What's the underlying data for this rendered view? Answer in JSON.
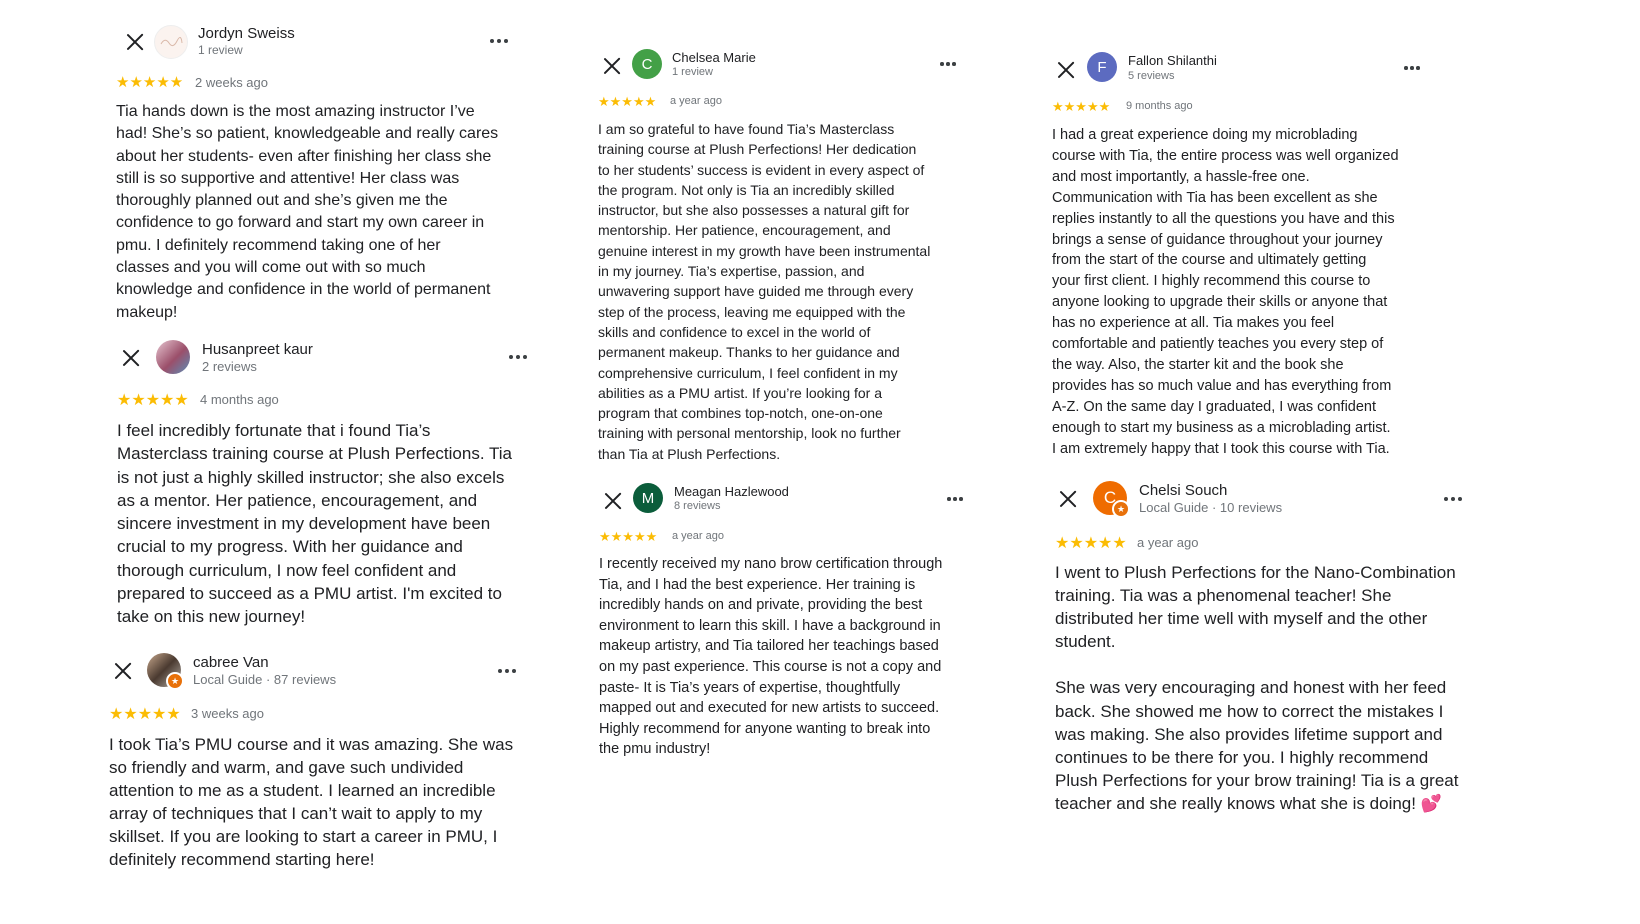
{
  "reviews": [
    {
      "name": "Jordyn Sweiss",
      "meta": "1 review",
      "stars": "★★★★★",
      "date": "2 weeks ago",
      "avatar_icon": "logo-image-avatar",
      "text": "Tia hands down is the most amazing instructor I’ve\nhad! She’s so patient, knowledgeable and really cares\nabout her students- even after finishing her class she\nstill is so supportive and attentive! Her class was\nthoroughly planned out and she’s given me the\nconfidence to go forward and start my own career in\npmu. I definitely recommend taking one of her\nclasses and you will come out with so much\nknowledge and confidence in the world of permanent\nmakeup!"
    },
    {
      "name": "Husanpreet kaur",
      "meta": "2 reviews",
      "stars": "★★★★★",
      "date": "4 months ago",
      "avatar_icon": "photo-avatar",
      "text": "I feel incredibly fortunate that i found Tia’s\nMasterclass training course at Plush Perfections. Tia\nis not just a highly skilled instructor; she also excels\nas a mentor. Her patience, encouragement, and\nsincere investment in my development have been\ncrucial to my progress. With her guidance and\nthorough curriculum, I now feel confident and\nprepared to succeed as a PMU artist. I'm excited to\ntake on this new journey!"
    },
    {
      "name": "cabree Van",
      "meta": "Local Guide · 87 reviews",
      "stars": "★★★★★",
      "date": "3 weeks ago",
      "avatar_icon": "photo-avatar",
      "text": "I took Tia’s PMU course and it was amazing. She was\nso friendly and warm, and gave such undivided\nattention to me as a student. I learned an incredible\narray of techniques that I can’t wait to apply to my\nskillset. If you are looking to start a career in PMU, I\ndefinitely recommend starting here!"
    },
    {
      "name": "Chelsea Marie",
      "meta": "1 review",
      "stars": "★★★★★",
      "date": "a year ago",
      "avatar_letter": "C",
      "avatar_color": "#43a047",
      "text": "I am so grateful to have found Tia’s Masterclass\ntraining course at Plush Perfections! Her dedication\nto her students’ success is evident in every aspect of\nthe program. Not only is Tia an incredibly skilled\ninstructor, but she also possesses a natural gift for\nmentorship. Her patience, encouragement, and\ngenuine interest in my growth have been instrumental\nin my journey. Tia’s expertise, passion, and\nunwavering support have guided me through every\nstep of the process, leaving me equipped with the\nskills and confidence to excel in the world of\npermanent makeup. Thanks to her guidance and\ncomprehensive curriculum, I feel confident in my\nabilities as a PMU artist. If you’re looking for a\nprogram that combines top-notch, one-on-one\ntraining with personal mentorship, look no further\nthan Tia at Plush Perfections."
    },
    {
      "name": "Meagan Hazlewood",
      "meta": "8 reviews",
      "stars": "★★★★★",
      "date": "a year ago",
      "avatar_letter": "M",
      "avatar_color": "#0b5d3b",
      "text": "I recently received my nano brow certification through\nTia, and I had the best experience. Her training is\nincredibly hands on and private, providing the best\nenvironment to learn this skill. I have a background in\nmakeup artistry, and Tia tailored her teachings based\non my past experience. This course is not a copy and\npaste- It is Tia’s years of expertise, thoughtfully\nmapped out and executed for new artists to succeed.\nHighly recommend for anyone wanting to break into\nthe pmu industry!"
    },
    {
      "name": "Fallon Shilanthi",
      "meta": "5 reviews",
      "stars": "★★★★★",
      "date": "9 months ago",
      "avatar_letter": "F",
      "avatar_color": "#5c6bc0",
      "text": "I had a great experience doing my microblading\ncourse with Tia, the entire process was well organized\nand most importantly, a hassle-free one.\nCommunication with Tia has been excellent as she\nreplies instantly to all the questions you have and this\nbrings a sense of guidance throughout your journey\nfrom the start of the course and ultimately getting\nyour first client. I highly recommend this course to\nanyone looking to upgrade their skills or anyone that\nhas no experience at all. Tia makes you feel\ncomfortable and patiently teaches you every step of\nthe way. Also, the starter kit and the book she\nprovides has so much value and has everything from\nA-Z. On the same day I graduated, I was confident\nenough to start my business as a microblading artist.\nI am extremely happy that I took this course with Tia."
    },
    {
      "name": "Chelsi Souch",
      "meta": "Local Guide · 10 reviews",
      "stars": "★★★★★",
      "date": "a year ago",
      "avatar_letter": "C",
      "avatar_color": "#ef6c00",
      "text": "I went to Plush Perfections for the Nano-Combination\ntraining. Tia was a phenomenal teacher!  She\ndistributed her time well with myself and the other\nstudent.\n\nShe was very encouraging and honest with her feed\nback. She showed me how to correct the mistakes I\nwas making. She also provides lifetime support and\ncontinues to be there for you. I highly recommend\nPlush Perfections for your brow training! Tia is a great\nteacher and she really knows what she is doing!  💕"
    }
  ]
}
